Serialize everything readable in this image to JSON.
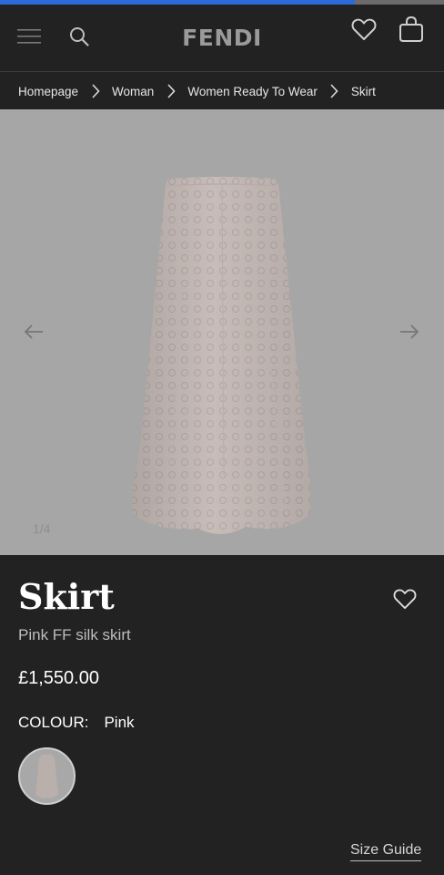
{
  "progress": {
    "percent": 80
  },
  "header": {
    "logo": "FENDI",
    "icons": {
      "menu": "hamburger-menu-icon",
      "search": "search-icon",
      "wishlist": "heart-outline-icon",
      "bag": "shopping-bag-icon"
    }
  },
  "breadcrumb": {
    "items": [
      "Homepage",
      "Woman",
      "Women Ready To Wear",
      "Skirt"
    ],
    "separator_icon": "chevron-right-icon"
  },
  "gallery": {
    "counter": "1/4",
    "image": "pink-silk-skirt-photo",
    "prev_icon": "arrow-left-icon",
    "next_icon": "arrow-right-icon"
  },
  "product": {
    "title": "Skirt",
    "subtitle": "Pink FF silk skirt",
    "price": "£1,550.00",
    "colour_label": "COLOUR:",
    "colour_value": "Pink",
    "swatch_image": "pink-skirt-thumbnail",
    "size_guide": "Size Guide",
    "wishlist_icon": "heart-outline-icon"
  },
  "colors": {
    "background": "#222223",
    "gallery_overlay": "#a6a6a6",
    "progress_fill": "#2d6ad9",
    "progress_track": "#6b6b6b",
    "logo": "#9a9a9a"
  }
}
